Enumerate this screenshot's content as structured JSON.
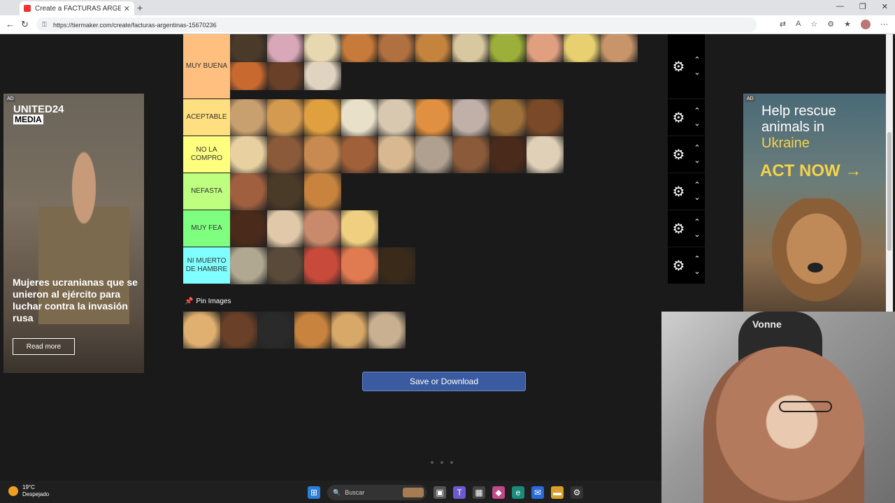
{
  "browser": {
    "tab_title": "Create a FACTURAS ARGENTINAS",
    "tab_close": "✕",
    "new_tab": "+",
    "url": "https://tiermaker.com/create/facturas-argentinas-15670236",
    "window_controls": [
      "—",
      "❐",
      "✕"
    ]
  },
  "tiers": [
    {
      "label": "MUY BUENA",
      "color": "#ffbf7f",
      "items": [
        "#4a3a2a",
        "#d9a8b8",
        "#e8d8b0",
        "#c77a3a",
        "#b07040",
        "#c4843e",
        "#d8c8a0",
        "#9caf3a",
        "#e0a080",
        "#e8d070",
        "#c8946a",
        "#c86a30",
        "#6a4028",
        "#e0d4c0"
      ]
    },
    {
      "label": "ACEPTABLE",
      "color": "#ffdf7f",
      "items": [
        "#c8a070",
        "#d49a50",
        "#e0a040",
        "#e8e0c8",
        "#d8c8b0",
        "#e09040",
        "#c0b0a8",
        "#a0703a",
        "#7a4a28"
      ]
    },
    {
      "label": "NO LA COMPRO",
      "color": "#ffff7f",
      "items": [
        "#e8d0a0",
        "#8a5a3a",
        "#c88a50",
        "#a0603a",
        "#d8b890",
        "#b0a090",
        "#8a5a3a",
        "#4a2a1a",
        "#e0d0b8"
      ]
    },
    {
      "label": "NEFASTA",
      "color": "#bfff7f",
      "items": [
        "#a06040",
        "#4a3a28",
        "#c8843e"
      ]
    },
    {
      "label": "MUY FEA",
      "color": "#7fff7f",
      "items": [
        "#4a2a1a",
        "#e0c8a8",
        "#c88a6a",
        "#f0d080"
      ]
    },
    {
      "label": "NI MUERTO\nDE HAMBRE",
      "color": "#7fffff",
      "items": [
        "#b0a890",
        "#5a4a3a",
        "#c84a3a",
        "#e07a50",
        "#3a2a1a"
      ]
    }
  ],
  "pin_images": {
    "label": "Pin Images",
    "items": [
      "#e0b070",
      "#6a4028",
      "#2a2a2a",
      "#c8843e",
      "#d8a868",
      "#c8b090"
    ]
  },
  "save_button": "Save or Download",
  "ad_left": {
    "badge": "AD",
    "brand_line1": "UNITED24",
    "brand_line2": "MEDIA",
    "headline": "Mujeres ucranianas que se unieron al ejército para luchar contra la invasión rusa",
    "cta": "Read more"
  },
  "ad_right": {
    "badge": "AD",
    "line1": "Help rescue animals in",
    "line2": "Ukraine",
    "cta": "ACT NOW →"
  },
  "webcam": {
    "chair_brand": "Vonne"
  },
  "taskbar": {
    "temperature": "19°C",
    "condition": "Despejado",
    "search_placeholder": "Buscar"
  }
}
